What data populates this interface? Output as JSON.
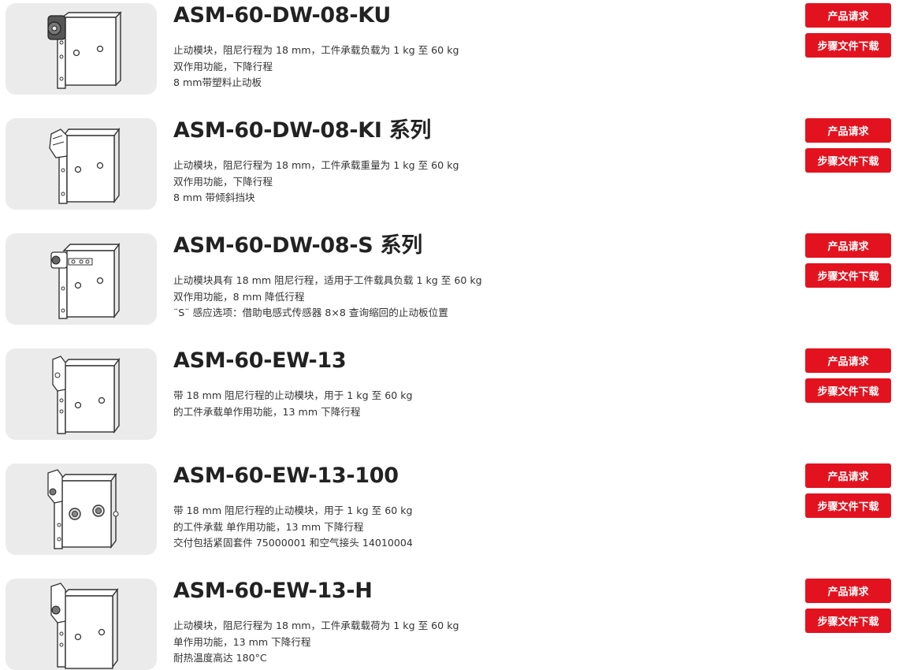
{
  "labels": {
    "request_button": "产品请求",
    "download_button": "步骤文件下载"
  },
  "colors": {
    "button_bg": "#e2131f",
    "thumb_bg": "#ebebeb"
  },
  "icons": {
    "thumbnail": "product-image"
  },
  "products": [
    {
      "title": "ASM-60-DW-08-KU",
      "lines": [
        "止动模块，阻尼行程为 18 mm，工件承载负载为 1 kg 至 60 kg",
        "双作用功能，下降行程",
        "8 mm带塑料止动板"
      ]
    },
    {
      "title": "ASM-60-DW-08-KI 系列",
      "lines": [
        "止动模块，阻尼行程为 18 mm，工件承载重量为 1 kg 至 60 kg",
        "双作用功能，下降行程",
        "8 mm 带倾斜挡块"
      ]
    },
    {
      "title": "ASM-60-DW-08-S 系列",
      "lines": [
        "止动模块具有 18 mm 阻尼行程，适用于工件载具负载 1 kg 至 60 kg",
        "双作用功能，8 mm 降低行程",
        "¨S¨ 感应选项：借助电感式传感器 8×8 查询缩回的止动板位置"
      ]
    },
    {
      "title": "ASM-60-EW-13",
      "lines": [
        "带 18 mm 阻尼行程的止动模块，用于 1 kg 至 60 kg",
        "的工件承载单作用功能，13 mm 下降行程"
      ]
    },
    {
      "title": "ASM-60-EW-13-100",
      "lines": [
        "带 18 mm 阻尼行程的止动模块，用于 1 kg 至 60 kg",
        "的工件承载 单作用功能，13 mm 下降行程",
        "交付包括紧固套件 75000001 和空气接头 14010004"
      ]
    },
    {
      "title": "ASM-60-EW-13-H",
      "lines": [
        "止动模块，阻尼行程为 18 mm，工件承载载荷为 1 kg 至 60 kg",
        "单作用功能，13 mm 下降行程",
        "耐热温度高达 180°C"
      ]
    }
  ]
}
